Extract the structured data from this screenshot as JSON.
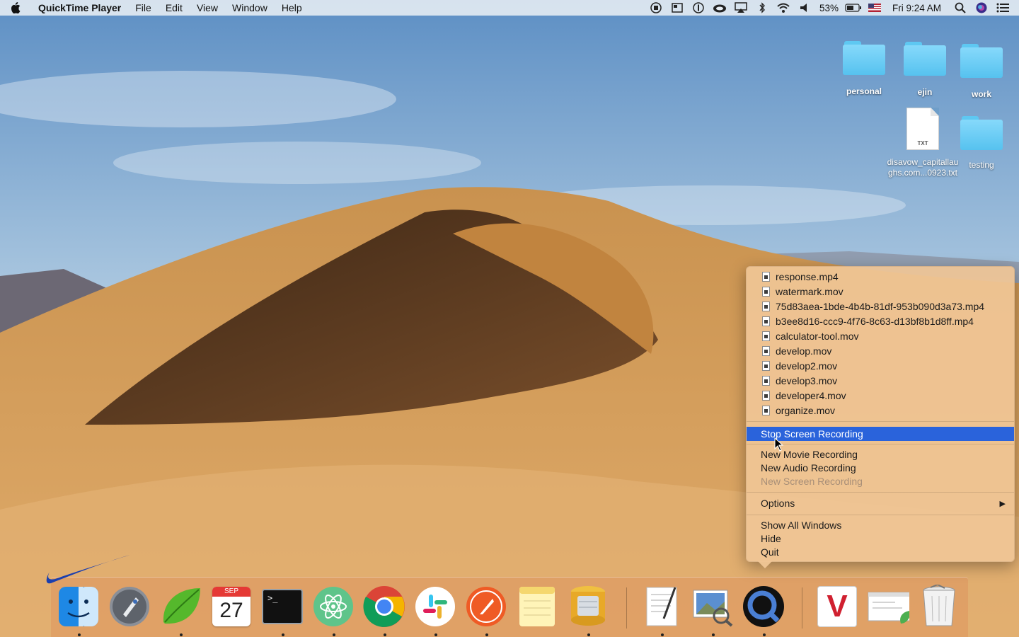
{
  "menubar": {
    "app_name": "QuickTime Player",
    "menus": [
      "File",
      "Edit",
      "View",
      "Window",
      "Help"
    ],
    "battery_percent": "53%",
    "clock": "Fri 9:24 AM"
  },
  "desktop": {
    "icons": [
      {
        "label": "personal",
        "kind": "folder"
      },
      {
        "label": "ejin",
        "kind": "folder"
      },
      {
        "label": "work",
        "kind": "folder"
      },
      {
        "label": "disavow_capitallau ghs.com...0923.txt",
        "kind": "txt",
        "ext": "TXT"
      },
      {
        "label": "testing",
        "kind": "folder"
      }
    ]
  },
  "dock_menu": {
    "recent_files": [
      "response.mp4",
      "watermark.mov",
      "75d83aea-1bde-4b4b-81df-953b090d3a73.mp4",
      "b3ee8d16-ccc9-4f76-8c63-d13bf8b1d8ff.mp4",
      "calculator-tool.mov",
      "develop.mov",
      "develop2.mov",
      "develop3.mov",
      "developer4.mov",
      "organize.mov"
    ],
    "stop_recording": "Stop Screen Recording",
    "new_movie": "New Movie Recording",
    "new_audio": "New Audio Recording",
    "new_screen": "New Screen Recording",
    "options": "Options",
    "show_all": "Show All Windows",
    "hide": "Hide",
    "quit": "Quit"
  },
  "dock": {
    "calendar_month": "SEP",
    "calendar_day": "27",
    "terminal_prompt": ">_",
    "vivaldi_letter": "V",
    "apps": [
      "finder",
      "launchpad",
      "coda",
      "calendar",
      "terminal",
      "atom",
      "chrome",
      "slack",
      "postman",
      "notes",
      "sequel-pro",
      "textedit",
      "preview",
      "quicktime",
      "vivaldi",
      "screenshot",
      "trash"
    ]
  },
  "colors": {
    "menu_highlight": "#2a63db",
    "dock_menu_bg": "#f0c696",
    "folder_blue": "#56c2ef"
  }
}
